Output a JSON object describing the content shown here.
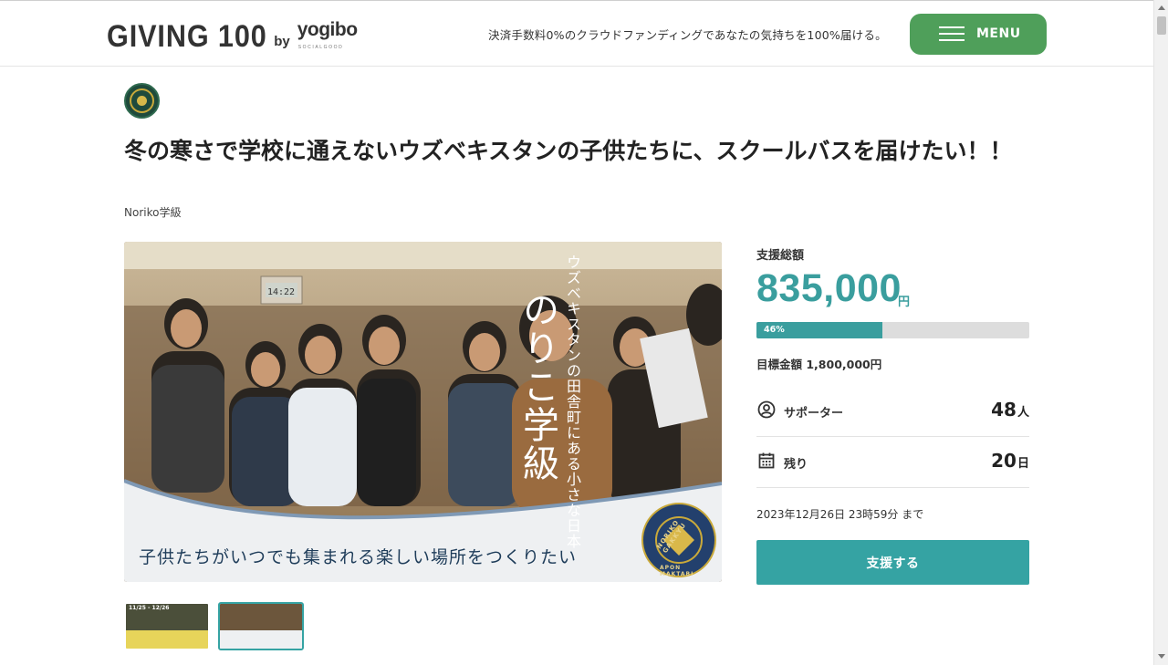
{
  "header": {
    "logo_main": "GIVING 100",
    "logo_by": "by",
    "logo_brand": "yogibo",
    "logo_brand_sub": "SOCIALGOOD",
    "tagline": "決済手数料0%のクラウドファンディングであなたの気持ちを100%届ける。",
    "menu_label": "MENU"
  },
  "project": {
    "title": "冬の寒さで学校に通えないウズベキスタンの子供たちに、スクールバスを届けたい！！",
    "organizer": "Noriko学級"
  },
  "hero": {
    "vertical_subtitle": "ウズベキスタンの田舎町にある小さな日本",
    "vertical_title": "のりこ学級",
    "caption": "子供たちがいつでも集まれる楽しい場所をつくりたい",
    "seal_text_left": "NORIKO GAKKYU",
    "seal_text_right": "APON MAKTABI",
    "clock": "14:22"
  },
  "thumbnails": [
    {
      "label": "11/25 - 12/26",
      "active": false
    },
    {
      "label": "",
      "active": true
    }
  ],
  "funding": {
    "total_label": "支援総額",
    "amount": "835,000",
    "amount_unit": "円",
    "progress_percent": 46,
    "progress_text": "46%",
    "goal_text": "目標金額 1,800,000円",
    "supporters_label": "サポーター",
    "supporters_value": "48",
    "supporters_unit": "人",
    "remaining_label": "残り",
    "remaining_value": "20",
    "remaining_unit": "日",
    "deadline": "2023年12月26日 23時59分 まで",
    "support_button": "支援する"
  },
  "colors": {
    "accent": "#3a9e9e",
    "menu_green": "#4f9f5a",
    "progress_track": "#dddddd"
  },
  "icons": {
    "supporters": "user-circle-icon",
    "remaining": "calendar-icon",
    "menu": "hamburger-icon"
  }
}
